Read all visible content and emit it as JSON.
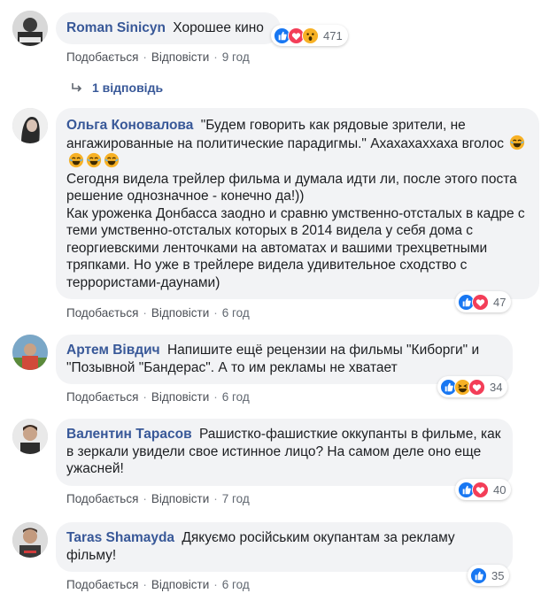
{
  "comments": [
    {
      "author": "Roman Sinicyn",
      "text": "Хорошее кино",
      "reactions": [
        "like-icon",
        "love-icon",
        "wow-icon"
      ],
      "reaction_count": "471",
      "like_label": "Подобається",
      "reply_label": "Відповісти",
      "time": "9 год"
    },
    {
      "author": "Ольга Коновалова",
      "text": "\"Будем говорить как рядовые зрители, не ангажированные на политические парадигмы.\" Ахахахаххаха вголос",
      "text_more": "Сегодня видела трейлер фильма и думала идти ли, после этого поста решение однозначное - конечно да!))\nКак уроженка Донбасса заодно и сравню умственно-отсталых в кадре с теми умственно-отсталых которых в 2014 видела у себя дома с георгиевскими ленточками на автоматах и вашими трехцветными тряпками. Но уже в трейлере видела удивительное сходство с террористами-даунами)",
      "reactions": [
        "like-icon",
        "love-icon"
      ],
      "reaction_count": "47",
      "like_label": "Подобається",
      "reply_label": "Відповісти",
      "time": "6 год"
    },
    {
      "author": "Артем Вівдич",
      "text": "Напишите ещё рецензии на фильмы \"Киборги\" и \"Позывной \"Бандерас\". А то им рекламы не хватает",
      "reactions": [
        "like-icon",
        "haha-icon",
        "love-icon"
      ],
      "reaction_count": "34",
      "like_label": "Подобається",
      "reply_label": "Відповісти",
      "time": "6 год"
    },
    {
      "author": "Валентин Тарасов",
      "text": "Рашистко-фашисткие оккупанты в фильме, как в зеркали увидели свое истинное лицо? На самом деле оно еще ужасней!",
      "reactions": [
        "like-icon",
        "love-icon"
      ],
      "reaction_count": "40",
      "like_label": "Подобається",
      "reply_label": "Відповісти",
      "time": "7 год"
    },
    {
      "author": "Taras Shamayda",
      "text": "Дякуємо російським окупантам за рекламу фільму!",
      "reactions": [
        "like-icon"
      ],
      "reaction_count": "35",
      "like_label": "Подобається",
      "reply_label": "Відповісти",
      "time": "6 год"
    }
  ],
  "replies_link": "1 відповідь",
  "colors": {
    "author": "#385898",
    "bubble": "#f2f3f5",
    "like": "#1877f2",
    "love": "#f33e58",
    "emoji": "#f7b125"
  }
}
